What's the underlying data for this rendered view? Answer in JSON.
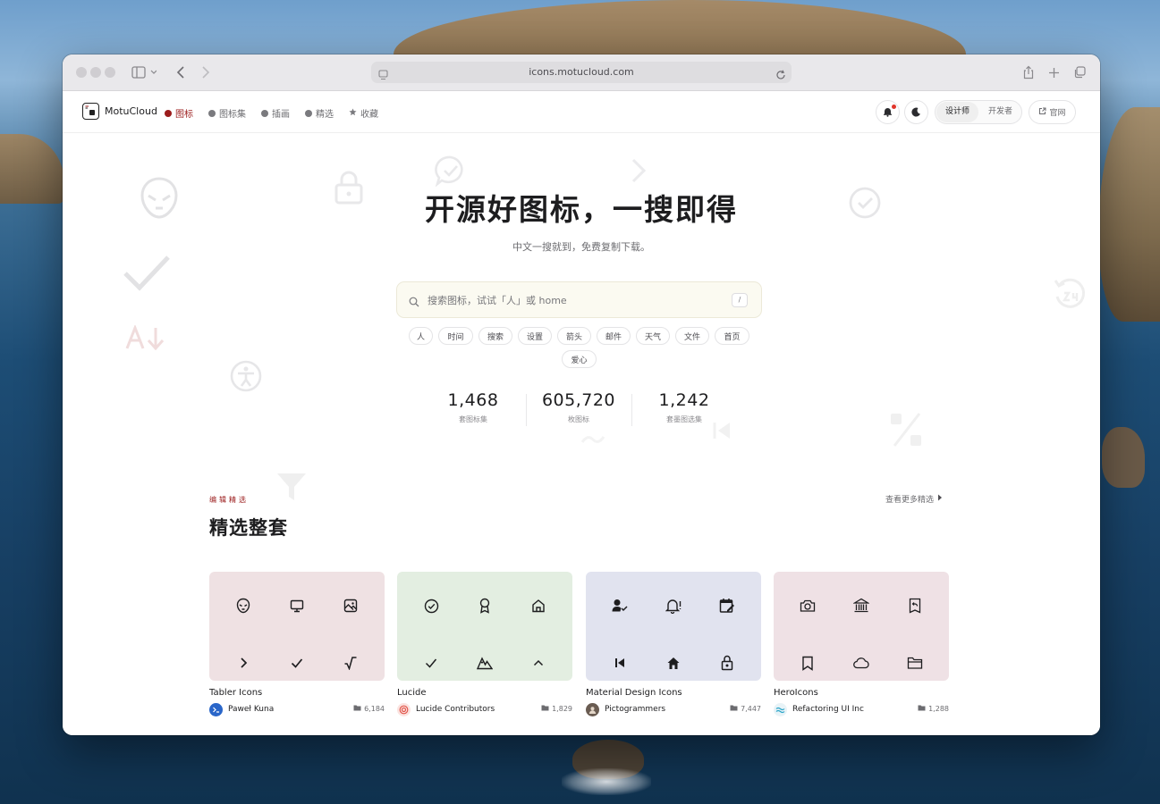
{
  "browser": {
    "url": "icons.motucloud.com"
  },
  "header": {
    "brand": "MotuCloud",
    "nav": [
      {
        "label": "图标",
        "icon": "icon-badge-icon",
        "active": true
      },
      {
        "label": "图标集",
        "icon": "cube-icon",
        "active": false
      },
      {
        "label": "插画",
        "icon": "cube-icon",
        "active": false
      },
      {
        "label": "精选",
        "icon": "check-badge-icon",
        "active": false
      },
      {
        "label": "收藏",
        "icon": "star-icon",
        "active": false
      }
    ],
    "role_segment": {
      "designer": "设计师",
      "developer": "开发者",
      "selected": "设计师"
    },
    "site_link": "官网"
  },
  "hero": {
    "title": "开源好图标，一搜即得",
    "subtitle": "中文一搜就到，免费复制下载。",
    "search_placeholder": "搜索图标，试试「人」或 home",
    "search_shortcut": "/",
    "chips": [
      "人",
      "时间",
      "搜索",
      "设置",
      "箭头",
      "邮件",
      "天气",
      "文件",
      "首页",
      "爱心"
    ],
    "stats": [
      {
        "value": "1,468",
        "label": "套图标集"
      },
      {
        "value": "605,720",
        "label": "枚图标"
      },
      {
        "value": "1,242",
        "label": "套墨图选集"
      }
    ]
  },
  "featured": {
    "kicker": "编辑精选",
    "title": "精选整套",
    "more_link": "查看更多精选",
    "cards": [
      {
        "name": "Tabler Icons",
        "author": "Paweł Kuna",
        "count": "6,184",
        "tile_color": "#efe1e3",
        "icons": [
          "alien-icon",
          "monitor-icon",
          "photo-icon",
          "chevron-right-icon",
          "check-icon",
          "square-root-icon"
        ]
      },
      {
        "name": "Lucide",
        "author": "Lucide Contributors",
        "count": "1,829",
        "tile_color": "#e3eee1",
        "icons": [
          "circle-check-icon",
          "award-icon",
          "house-icon",
          "check-icon",
          "mountain-icon",
          "chevron-up-icon"
        ]
      },
      {
        "name": "Material Design Icons",
        "author": "Pictogrammers",
        "count": "7,447",
        "tile_color": "#e1e3ef",
        "icons": [
          "account-check-icon",
          "bell-alert-icon",
          "calendar-edit-icon",
          "skip-previous-icon",
          "home-icon",
          "lock-open-icon"
        ]
      },
      {
        "name": "HeroIcons",
        "author": "Refactoring UI Inc",
        "count": "1,288",
        "tile_color": "#efe1e5",
        "icons": [
          "camera-icon",
          "building-library-icon",
          "receipt-refund-icon",
          "bookmark-icon",
          "cloud-icon",
          "folder-icon"
        ]
      }
    ]
  },
  "colors": {
    "accent": "#9b1c1c",
    "search_bg": "#fbfaf1"
  }
}
